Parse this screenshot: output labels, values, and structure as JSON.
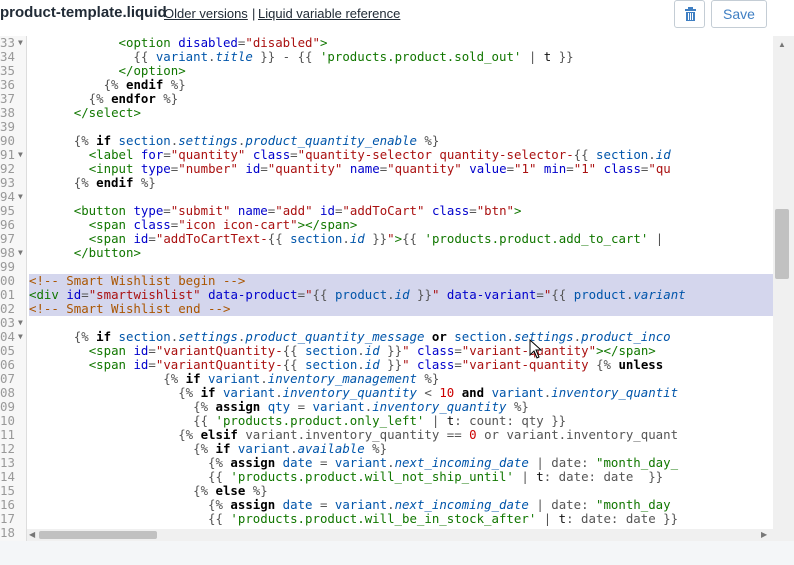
{
  "header": {
    "filename": "product-template.liquid",
    "older_versions": "Older versions",
    "separator": "|",
    "liquid_ref": "Liquid variable reference",
    "save_label": "Save",
    "delete_icon": "trash-icon"
  },
  "gutter": {
    "line_numbers": [
      "33",
      "34",
      "35",
      "36",
      "37",
      "38",
      "39",
      "90",
      "91",
      "92",
      "93",
      "94",
      "95",
      "96",
      "97",
      "98",
      "99",
      "00",
      "01",
      "02",
      "03",
      "04",
      "05",
      "06",
      "07",
      "08",
      "09",
      "10",
      "11",
      "12",
      "13",
      "14",
      "15",
      "16",
      "17",
      "18"
    ]
  },
  "code_lines": [
    [
      [
        "t-d",
        "            "
      ],
      [
        "t-tag",
        "<option"
      ],
      [
        "t-d",
        " "
      ],
      [
        "t-attr",
        "disabled"
      ],
      [
        "t-d",
        "="
      ],
      [
        "t-str",
        "\"disabled\""
      ],
      [
        "t-tag",
        ">"
      ]
    ],
    [
      [
        "t-d",
        "              {{ "
      ],
      [
        "t-var",
        "variant"
      ],
      [
        "t-d",
        "."
      ],
      [
        "t-prop",
        "title"
      ],
      [
        "t-d",
        " }} - {{ "
      ],
      [
        "t-lstr",
        "'products.product.sold_out'"
      ],
      [
        "t-d",
        " | "
      ],
      [
        "t-f",
        "t"
      ],
      [
        "t-d",
        " }}"
      ]
    ],
    [
      [
        "t-d",
        "            "
      ],
      [
        "t-tag",
        "</option>"
      ]
    ],
    [
      [
        "t-d",
        "          {% "
      ],
      [
        "t-kw",
        "endif"
      ],
      [
        "t-d",
        " %}"
      ]
    ],
    [
      [
        "t-d",
        "        {% "
      ],
      [
        "t-kw",
        "endfor"
      ],
      [
        "t-d",
        " %}"
      ]
    ],
    [
      [
        "t-d",
        "      "
      ],
      [
        "t-tag",
        "</select>"
      ]
    ],
    [
      [
        "t-d",
        ""
      ]
    ],
    [
      [
        "t-d",
        "      {% "
      ],
      [
        "t-kw",
        "if"
      ],
      [
        "t-d",
        " "
      ],
      [
        "t-var",
        "section"
      ],
      [
        "t-d",
        "."
      ],
      [
        "t-prop",
        "settings"
      ],
      [
        "t-d",
        "."
      ],
      [
        "t-prop",
        "product_quantity_enable"
      ],
      [
        "t-d",
        " %}"
      ]
    ],
    [
      [
        "t-d",
        "        "
      ],
      [
        "t-tag",
        "<label"
      ],
      [
        "t-d",
        " "
      ],
      [
        "t-attr",
        "for"
      ],
      [
        "t-d",
        "="
      ],
      [
        "t-str",
        "\"quantity\""
      ],
      [
        "t-d",
        " "
      ],
      [
        "t-attr",
        "class"
      ],
      [
        "t-d",
        "="
      ],
      [
        "t-str",
        "\"quantity-selector quantity-selector-"
      ],
      [
        "t-d",
        "{{ "
      ],
      [
        "t-var",
        "section"
      ],
      [
        "t-d",
        "."
      ],
      [
        "t-prop",
        "id"
      ]
    ],
    [
      [
        "t-d",
        "        "
      ],
      [
        "t-tag",
        "<input"
      ],
      [
        "t-d",
        " "
      ],
      [
        "t-attr",
        "type"
      ],
      [
        "t-d",
        "="
      ],
      [
        "t-str",
        "\"number\""
      ],
      [
        "t-d",
        " "
      ],
      [
        "t-attr",
        "id"
      ],
      [
        "t-d",
        "="
      ],
      [
        "t-str",
        "\"quantity\""
      ],
      [
        "t-d",
        " "
      ],
      [
        "t-attr",
        "name"
      ],
      [
        "t-d",
        "="
      ],
      [
        "t-str",
        "\"quantity\""
      ],
      [
        "t-d",
        " "
      ],
      [
        "t-attr",
        "value"
      ],
      [
        "t-d",
        "="
      ],
      [
        "t-str",
        "\"1\""
      ],
      [
        "t-d",
        " "
      ],
      [
        "t-attr",
        "min"
      ],
      [
        "t-d",
        "="
      ],
      [
        "t-str",
        "\"1\""
      ],
      [
        "t-d",
        " "
      ],
      [
        "t-attr",
        "class"
      ],
      [
        "t-d",
        "="
      ],
      [
        "t-str",
        "\"qu"
      ]
    ],
    [
      [
        "t-d",
        "      {% "
      ],
      [
        "t-kw",
        "endif"
      ],
      [
        "t-d",
        " %}"
      ]
    ],
    [
      [
        "t-d",
        ""
      ]
    ],
    [
      [
        "t-d",
        "      "
      ],
      [
        "t-tag",
        "<button"
      ],
      [
        "t-d",
        " "
      ],
      [
        "t-attr",
        "type"
      ],
      [
        "t-d",
        "="
      ],
      [
        "t-str",
        "\"submit\""
      ],
      [
        "t-d",
        " "
      ],
      [
        "t-attr",
        "name"
      ],
      [
        "t-d",
        "="
      ],
      [
        "t-str",
        "\"add\""
      ],
      [
        "t-d",
        " "
      ],
      [
        "t-attr",
        "id"
      ],
      [
        "t-d",
        "="
      ],
      [
        "t-str",
        "\"addToCart\""
      ],
      [
        "t-d",
        " "
      ],
      [
        "t-attr",
        "class"
      ],
      [
        "t-d",
        "="
      ],
      [
        "t-str",
        "\"btn\""
      ],
      [
        "t-tag",
        ">"
      ]
    ],
    [
      [
        "t-d",
        "        "
      ],
      [
        "t-tag",
        "<span"
      ],
      [
        "t-d",
        " "
      ],
      [
        "t-attr",
        "class"
      ],
      [
        "t-d",
        "="
      ],
      [
        "t-str",
        "\"icon icon-cart\""
      ],
      [
        "t-tag",
        "></span>"
      ]
    ],
    [
      [
        "t-d",
        "        "
      ],
      [
        "t-tag",
        "<span"
      ],
      [
        "t-d",
        " "
      ],
      [
        "t-attr",
        "id"
      ],
      [
        "t-d",
        "="
      ],
      [
        "t-str",
        "\"addToCartText-"
      ],
      [
        "t-d",
        "{{ "
      ],
      [
        "t-var",
        "section"
      ],
      [
        "t-d",
        "."
      ],
      [
        "t-prop",
        "id"
      ],
      [
        "t-d",
        " }}"
      ],
      [
        "t-str",
        "\""
      ],
      [
        "t-tag",
        ">"
      ],
      [
        "t-d",
        "{{ "
      ],
      [
        "t-lstr",
        "'products.product.add_to_cart'"
      ],
      [
        "t-d",
        " |"
      ]
    ],
    [
      [
        "t-d",
        "      "
      ],
      [
        "t-tag",
        "</button>"
      ]
    ],
    [
      [
        "t-d",
        ""
      ]
    ],
    [
      [
        "t-com",
        "<!-- Smart Wishlist begin -->"
      ]
    ],
    [
      [
        "t-tag",
        "<div"
      ],
      [
        "t-d",
        " "
      ],
      [
        "t-attr",
        "id"
      ],
      [
        "t-d",
        "="
      ],
      [
        "t-str",
        "\"smartwishlist\""
      ],
      [
        "t-d",
        " "
      ],
      [
        "t-attr",
        "data-product"
      ],
      [
        "t-d",
        "="
      ],
      [
        "t-str",
        "\""
      ],
      [
        "t-d",
        "{{ "
      ],
      [
        "t-var",
        "product"
      ],
      [
        "t-d",
        "."
      ],
      [
        "t-prop",
        "id"
      ],
      [
        "t-d",
        " }}"
      ],
      [
        "t-str",
        "\""
      ],
      [
        "t-d",
        " "
      ],
      [
        "t-attr",
        "data-variant"
      ],
      [
        "t-d",
        "="
      ],
      [
        "t-str",
        "\""
      ],
      [
        "t-d",
        "{{ "
      ],
      [
        "t-var",
        "product"
      ],
      [
        "t-d",
        "."
      ],
      [
        "t-prop",
        "variant"
      ]
    ],
    [
      [
        "t-com",
        "<!-- Smart Wishlist end -->"
      ]
    ],
    [
      [
        "t-d",
        ""
      ]
    ],
    [
      [
        "t-d",
        "      {% "
      ],
      [
        "t-kw",
        "if"
      ],
      [
        "t-d",
        " "
      ],
      [
        "t-var",
        "section"
      ],
      [
        "t-d",
        "."
      ],
      [
        "t-prop",
        "settings"
      ],
      [
        "t-d",
        "."
      ],
      [
        "t-prop",
        "product_quantity_message"
      ],
      [
        "t-d",
        " "
      ],
      [
        "t-kw",
        "or"
      ],
      [
        "t-d",
        " "
      ],
      [
        "t-var",
        "section"
      ],
      [
        "t-d",
        "."
      ],
      [
        "t-prop",
        "settings"
      ],
      [
        "t-d",
        "."
      ],
      [
        "t-prop",
        "product_inco"
      ]
    ],
    [
      [
        "t-d",
        "        "
      ],
      [
        "t-tag",
        "<span"
      ],
      [
        "t-d",
        " "
      ],
      [
        "t-attr",
        "id"
      ],
      [
        "t-d",
        "="
      ],
      [
        "t-str",
        "\"variantQuantity-"
      ],
      [
        "t-d",
        "{{ "
      ],
      [
        "t-var",
        "section"
      ],
      [
        "t-d",
        "."
      ],
      [
        "t-prop",
        "id"
      ],
      [
        "t-d",
        " }}"
      ],
      [
        "t-str",
        "\""
      ],
      [
        "t-d",
        " "
      ],
      [
        "t-attr",
        "class"
      ],
      [
        "t-d",
        "="
      ],
      [
        "t-str",
        "\"variant-quantity\""
      ],
      [
        "t-tag",
        "></span>"
      ]
    ],
    [
      [
        "t-d",
        "        "
      ],
      [
        "t-tag",
        "<span"
      ],
      [
        "t-d",
        " "
      ],
      [
        "t-attr",
        "id"
      ],
      [
        "t-d",
        "="
      ],
      [
        "t-str",
        "\"variantQuantity-"
      ],
      [
        "t-d",
        "{{ "
      ],
      [
        "t-var",
        "section"
      ],
      [
        "t-d",
        "."
      ],
      [
        "t-prop",
        "id"
      ],
      [
        "t-d",
        " }}"
      ],
      [
        "t-str",
        "\""
      ],
      [
        "t-d",
        " "
      ],
      [
        "t-attr",
        "class"
      ],
      [
        "t-d",
        "="
      ],
      [
        "t-str",
        "\"variant-quantity"
      ],
      [
        "t-d",
        " {% "
      ],
      [
        "t-kw",
        "unless"
      ]
    ],
    [
      [
        "t-d",
        "                  {% "
      ],
      [
        "t-kw",
        "if"
      ],
      [
        "t-d",
        " "
      ],
      [
        "t-var",
        "variant"
      ],
      [
        "t-d",
        "."
      ],
      [
        "t-prop",
        "inventory_management"
      ],
      [
        "t-d",
        " %}"
      ]
    ],
    [
      [
        "t-d",
        "                    {% "
      ],
      [
        "t-kw",
        "if"
      ],
      [
        "t-d",
        " "
      ],
      [
        "t-var",
        "variant"
      ],
      [
        "t-d",
        "."
      ],
      [
        "t-prop",
        "inventory_quantity"
      ],
      [
        "t-d",
        " < "
      ],
      [
        "t-num",
        "10"
      ],
      [
        "t-d",
        " "
      ],
      [
        "t-kw",
        "and"
      ],
      [
        "t-d",
        " "
      ],
      [
        "t-var",
        "variant"
      ],
      [
        "t-d",
        "."
      ],
      [
        "t-prop",
        "inventory_quantit"
      ]
    ],
    [
      [
        "t-d",
        "                      {% "
      ],
      [
        "t-kw",
        "assign"
      ],
      [
        "t-d",
        " "
      ],
      [
        "t-var",
        "qty"
      ],
      [
        "t-d",
        " = "
      ],
      [
        "t-var",
        "variant"
      ],
      [
        "t-d",
        "."
      ],
      [
        "t-prop",
        "inventory_quantity"
      ],
      [
        "t-d",
        " %}"
      ]
    ],
    [
      [
        "t-d",
        "                      {{ "
      ],
      [
        "t-lstr",
        "'products.product.only_left'"
      ],
      [
        "t-d",
        " | "
      ],
      [
        "t-f",
        "t"
      ],
      [
        "t-d",
        ": count: qty }}"
      ]
    ],
    [
      [
        "t-d",
        "                    {% "
      ],
      [
        "t-kw",
        "elsif"
      ],
      [
        "t-d",
        " variant.inventory_quantity == "
      ],
      [
        "t-num",
        "0"
      ],
      [
        "t-d",
        " or variant.inventory_quant"
      ]
    ],
    [
      [
        "t-d",
        "                      {% "
      ],
      [
        "t-kw",
        "if"
      ],
      [
        "t-d",
        " "
      ],
      [
        "t-var",
        "variant"
      ],
      [
        "t-d",
        "."
      ],
      [
        "t-prop",
        "available"
      ],
      [
        "t-d",
        " %}"
      ]
    ],
    [
      [
        "t-d",
        "                        {% "
      ],
      [
        "t-kw",
        "assign"
      ],
      [
        "t-d",
        " "
      ],
      [
        "t-var",
        "date"
      ],
      [
        "t-d",
        " = "
      ],
      [
        "t-var",
        "variant"
      ],
      [
        "t-d",
        "."
      ],
      [
        "t-prop",
        "next_incoming_date"
      ],
      [
        "t-d",
        " | date: "
      ],
      [
        "t-lstr",
        "\"month_day_"
      ]
    ],
    [
      [
        "t-d",
        "                        {{ "
      ],
      [
        "t-lstr",
        "'products.product.will_not_ship_until'"
      ],
      [
        "t-d",
        " | "
      ],
      [
        "t-f",
        "t"
      ],
      [
        "t-d",
        ": date: date  }}"
      ]
    ],
    [
      [
        "t-d",
        "                      {% "
      ],
      [
        "t-kw",
        "else"
      ],
      [
        "t-d",
        " %}"
      ]
    ],
    [
      [
        "t-d",
        "                        {% "
      ],
      [
        "t-kw",
        "assign"
      ],
      [
        "t-d",
        " "
      ],
      [
        "t-var",
        "date"
      ],
      [
        "t-d",
        " = "
      ],
      [
        "t-var",
        "variant"
      ],
      [
        "t-d",
        "."
      ],
      [
        "t-prop",
        "next_incoming_date"
      ],
      [
        "t-d",
        " | date: "
      ],
      [
        "t-lstr",
        "\"month_day"
      ]
    ],
    [
      [
        "t-d",
        "                        {{ "
      ],
      [
        "t-lstr",
        "'products.product.will_be_in_stock_after'"
      ],
      [
        "t-d",
        " | "
      ],
      [
        "t-f",
        "t"
      ],
      [
        "t-d",
        ": date: date }}"
      ]
    ],
    [
      [
        "t-d",
        ""
      ]
    ]
  ],
  "highlighted_lines": [
    17,
    18,
    19
  ],
  "fold_lines": [
    0,
    8,
    11,
    15,
    20,
    21
  ]
}
